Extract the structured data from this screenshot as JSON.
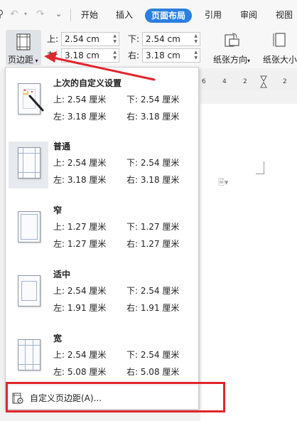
{
  "tabs": [
    "开始",
    "插入",
    "页面布局",
    "引用",
    "审阅",
    "视图"
  ],
  "active_tab": "页面布局",
  "ribbon": {
    "margins_label": "页边距",
    "top_label": "上:",
    "top_value": "2.54 cm",
    "bottom_label": "下:",
    "bottom_value": "2.54 cm",
    "left_label": "左:",
    "left_value": "3.18 cm",
    "right_label": "右:",
    "right_value": "3.18 cm",
    "orientation_label": "纸张方向",
    "size_label": "纸张大小"
  },
  "ruler_ticks": [
    "6",
    "4",
    "2",
    "2"
  ],
  "menu": {
    "presets": [
      {
        "name": "上次的自定义设置",
        "top": "上: 2.54 厘米",
        "bottom": "下: 2.54 厘米",
        "left": "左: 3.18 厘米",
        "right": "右: 3.18 厘米"
      },
      {
        "name": "普通",
        "top": "上: 2.54 厘米",
        "bottom": "下: 2.54 厘米",
        "left": "左: 3.18 厘米",
        "right": "右: 3.18 厘米"
      },
      {
        "name": "窄",
        "top": "上: 1.27 厘米",
        "bottom": "下: 1.27 厘米",
        "left": "左: 1.27 厘米",
        "right": "右: 1.27 厘米"
      },
      {
        "name": "适中",
        "top": "上: 2.54 厘米",
        "bottom": "下: 2.54 厘米",
        "left": "左: 1.91 厘米",
        "right": "右: 1.91 厘米"
      },
      {
        "name": "宽",
        "top": "上: 2.54 厘米",
        "bottom": "下: 2.54 厘米",
        "left": "左: 5.08 厘米",
        "right": "右: 5.08 厘米"
      }
    ],
    "custom_label": "自定义页边距(A)..."
  },
  "colors": {
    "accent": "#2a7fe0",
    "annotation": "#e0262c"
  }
}
